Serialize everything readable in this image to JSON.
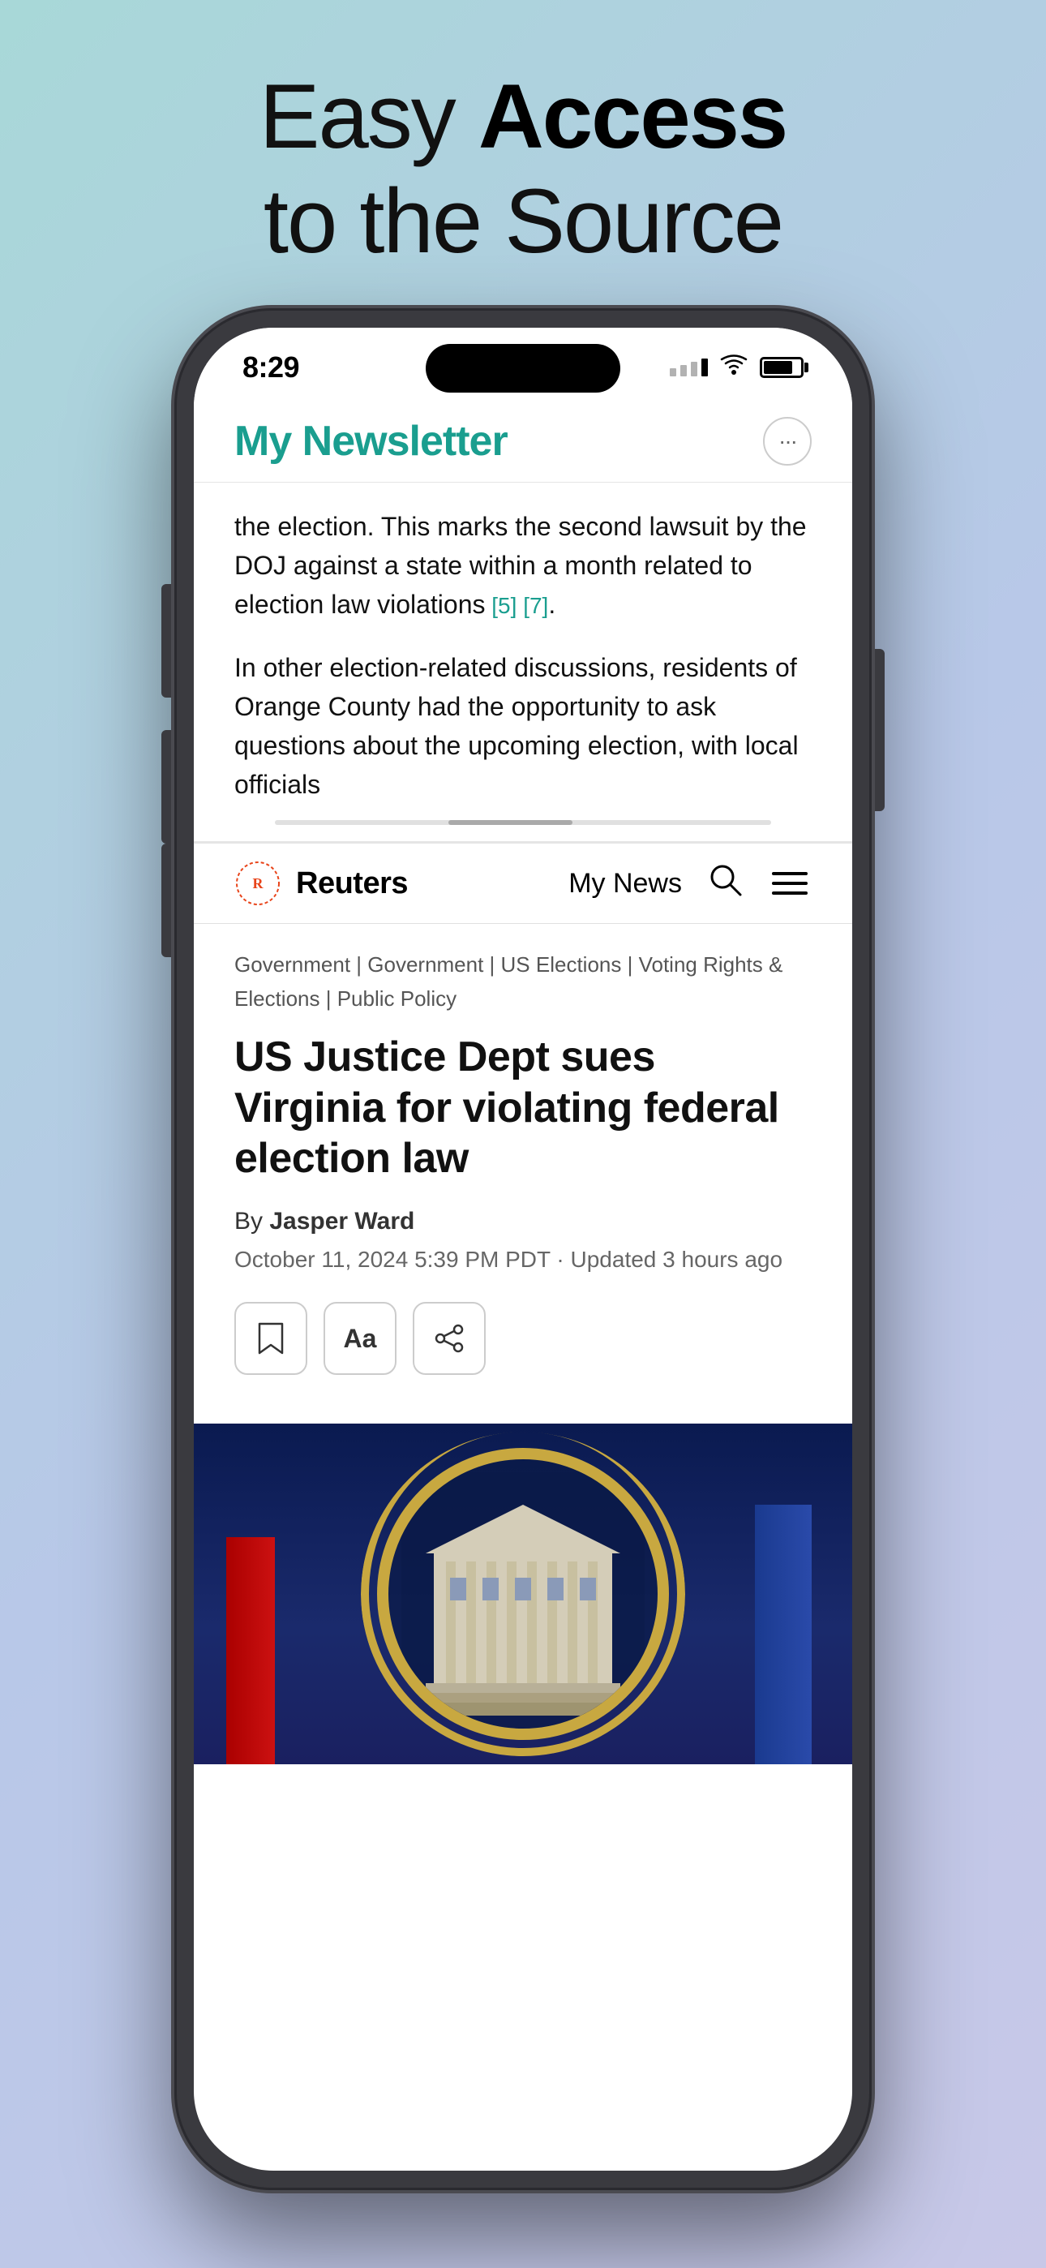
{
  "headline": {
    "line1": "Easy ",
    "line1_bold": "Access",
    "line2": "to the Source"
  },
  "status_bar": {
    "time": "8:29",
    "signal_bars": 4,
    "wifi": "wifi",
    "battery": "battery"
  },
  "newsletter": {
    "title": "My Newsletter",
    "more_button_label": "···"
  },
  "preview_text": {
    "paragraph1": "the election. This marks the second lawsuit by the DOJ against a state within a month related to election law violations",
    "citations": " [5] [7]",
    "period": ".",
    "paragraph2": "In other election-related discussions, residents of Orange County had the opportunity to ask questions about the upcoming election, with local officials"
  },
  "bottom_nav": {
    "brand": "Reuters",
    "my_news": "My News",
    "search_label": "search",
    "menu_label": "menu"
  },
  "article": {
    "categories": "Government | Government | US Elections | Voting Rights & Elections | Public Policy",
    "title": "US Justice Dept sues Virginia for violating federal election law",
    "by_prefix": "By ",
    "author": "Jasper Ward",
    "date": "October 11, 2024 5:39 PM PDT · Updated 3 hours ago",
    "actions": {
      "bookmark": "🔖",
      "font": "Aa",
      "share": "⤴"
    }
  }
}
